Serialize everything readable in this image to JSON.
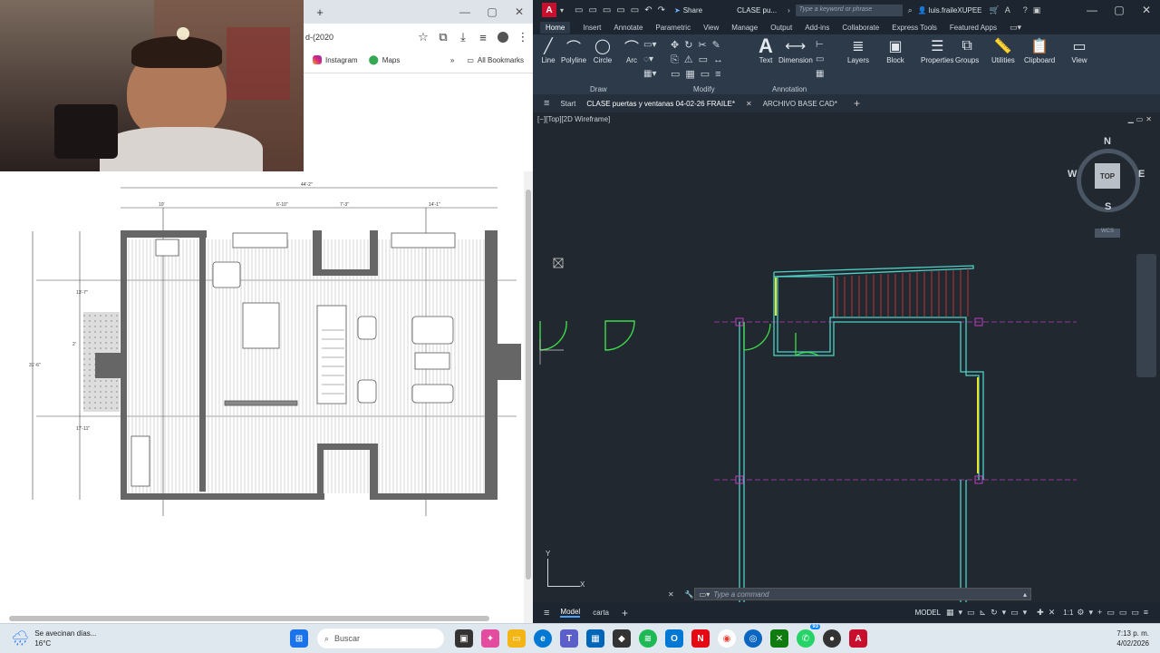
{
  "chrome": {
    "new_tab": "+",
    "address": "d-(2020",
    "bookmarks": [
      {
        "label": "Instagram",
        "icon": "instagram-icon"
      },
      {
        "label": "Maps",
        "icon": "maps-icon"
      }
    ],
    "all_bookmarks": "All Bookmarks"
  },
  "drawing": {
    "overall_width": "44'-2\"",
    "dims_top": [
      "10'",
      "6'-10\"",
      "7'-3\"",
      "14'-1\""
    ],
    "side_dims": [
      "13'-7\"",
      "31'-6\"",
      "17'-11\"",
      "2'"
    ]
  },
  "autocad": {
    "app_letter": "A",
    "share": "Share",
    "file_title": "CLASE pu...",
    "search_placeholder": "Type a keyword or phrase",
    "user": "luis.fraileXUPEE",
    "ribbon_tabs": [
      "Home",
      "Insert",
      "Annotate",
      "Parametric",
      "View",
      "Manage",
      "Output",
      "Add-ins",
      "Collaborate",
      "Express Tools",
      "Featured Apps"
    ],
    "draw_tools": [
      "Line",
      "Polyline",
      "Circle",
      "Arc"
    ],
    "annotation_tools": [
      "Text",
      "Dimension"
    ],
    "large_tools": [
      "Layers",
      "Block",
      "Properties",
      "Groups",
      "Utilities",
      "Clipboard",
      "View"
    ],
    "panel_labels": [
      "Draw",
      "Modify",
      "Annotation"
    ],
    "doc_tabs": [
      "Start",
      "CLASE puertas y ventanas 04-02-26 FRAILE*",
      "ARCHIVO BASE CAD*"
    ],
    "viewport_label": "[−][Top][2D Wireframe]",
    "compass": {
      "n": "N",
      "s": "S",
      "e": "E",
      "w": "W",
      "top": "TOP",
      "wcs": "WCS"
    },
    "ucs": {
      "x": "X",
      "y": "Y"
    },
    "command_placeholder": "Type a command",
    "layout_tabs": [
      "Model",
      "carta"
    ],
    "status_model": "MODEL",
    "status_scale": "1:1"
  },
  "taskbar": {
    "weather_title": "Se avecinan días...",
    "weather_temp": "16°C",
    "search": "Buscar",
    "time": "7:13 p. m.",
    "date": "4/02/2026",
    "badge": "93"
  },
  "colors": {
    "acad_bg": "#212830",
    "wall_cyan": "#4fd1c5",
    "green": "#3ddc4a",
    "yellow": "#e6e62b",
    "red_stair": "#d0303a",
    "magenta": "#c03ec0"
  }
}
